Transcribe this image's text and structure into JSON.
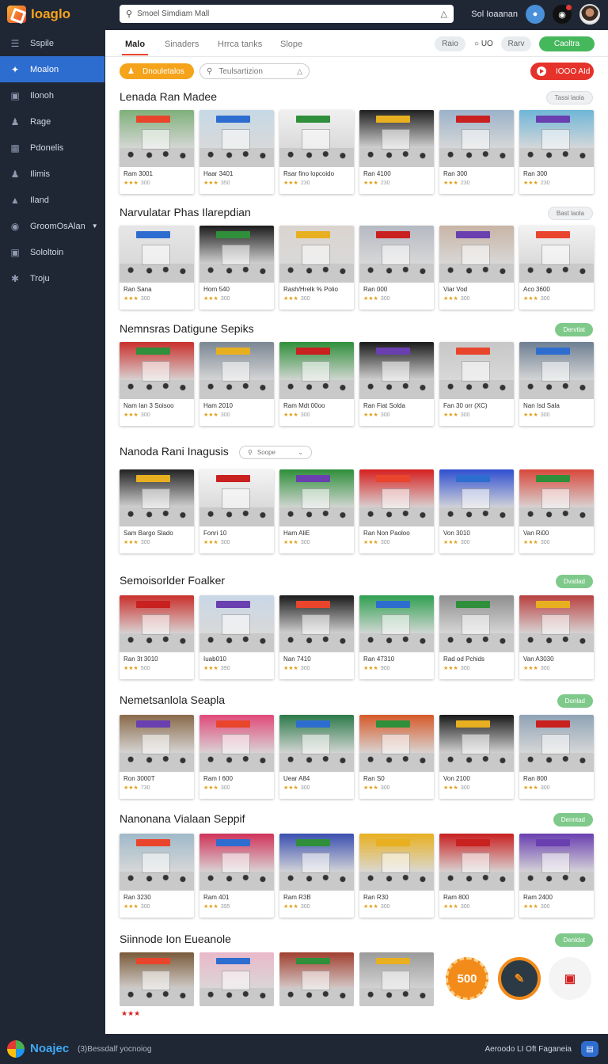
{
  "app": {
    "name": "Ioaglo",
    "search_placeholder": "Smoel Simdiam Mall",
    "top_link": "Sol Ioaanan"
  },
  "sidebar": [
    {
      "label": "Sspile",
      "icon": "menu-icon"
    },
    {
      "label": "Moalon",
      "icon": "bird-icon"
    },
    {
      "label": "Ilonoh",
      "icon": "bag-icon"
    },
    {
      "label": "Rage",
      "icon": "user-icon"
    },
    {
      "label": "Pdonelis",
      "icon": "chart-icon"
    },
    {
      "label": "Ilimis",
      "icon": "person-icon"
    },
    {
      "label": "Iland",
      "icon": "pin-icon"
    },
    {
      "label": "GroomOsAlan",
      "icon": "globe-icon"
    },
    {
      "label": "Sololtoin",
      "icon": "shield-icon"
    },
    {
      "label": "Troju",
      "icon": "gear-icon"
    }
  ],
  "tabs": [
    "Malo",
    "Sinaders",
    "Hrrca tanks",
    "Slope"
  ],
  "tab_controls": {
    "pill1": "Raio",
    "ring": "○ UO",
    "pill2": "Rarv",
    "pill3": "Caoltra"
  },
  "toolbar": {
    "orange": "Dnouletalos",
    "filter": "Teulsartizion",
    "red": "IOOO AId"
  },
  "sections": [
    {
      "title": "Lenada Ran Madee",
      "action": "Tassi laola",
      "action_style": "grey",
      "cards": [
        {
          "name": "Ram 3001",
          "score": "300"
        },
        {
          "name": "Haar 3401",
          "score": "350"
        },
        {
          "name": "Rsar fino lopcoido",
          "score": "230"
        },
        {
          "name": "Ran 4100",
          "score": "230"
        },
        {
          "name": "Ran 300",
          "score": "230"
        },
        {
          "name": "Ran 300",
          "score": "230"
        }
      ]
    },
    {
      "title": "Narvulatar Phas Ilarepdian",
      "action": "Bast laola",
      "action_style": "grey",
      "cards": [
        {
          "name": "Ran Sana",
          "score": "300"
        },
        {
          "name": "Horn 540",
          "score": "300"
        },
        {
          "name": "Rash/Hrelk % Polio",
          "score": "300"
        },
        {
          "name": "Ran 000",
          "score": "300"
        },
        {
          "name": "Viar Vod",
          "score": "300"
        },
        {
          "name": "Aco 3600",
          "score": "300"
        }
      ]
    },
    {
      "title": "Nemnsras Datigune Sepiks",
      "action": "Dervtlat",
      "action_style": "green",
      "cards": [
        {
          "name": "Nam Ian 3 Soisoo",
          "score": "300"
        },
        {
          "name": "Ham 2010",
          "score": "300"
        },
        {
          "name": "Ram Mdt 00oo",
          "score": "300"
        },
        {
          "name": "Ran Fiat Solda",
          "score": "300"
        },
        {
          "name": "Fan 30 orr (XC)",
          "score": "300"
        },
        {
          "name": "Nan Isd Sala",
          "score": "300"
        }
      ]
    },
    {
      "title": "Nanoda Rani Inagusis",
      "action": "Soope",
      "action_style": "search",
      "cards": [
        {
          "name": "Sam Bargo Slado",
          "score": "300"
        },
        {
          "name": "Fonri 10",
          "score": "300"
        },
        {
          "name": "Harn AliE",
          "score": "300"
        },
        {
          "name": "Ran Non Paoloo",
          "score": "300"
        },
        {
          "name": "Von 3010",
          "score": "300"
        },
        {
          "name": "Van Ri00",
          "score": "300"
        }
      ]
    },
    {
      "title": "Semoisorlder Foalker",
      "action": "Dvatlad",
      "action_style": "green",
      "cards": [
        {
          "name": "Ran 3t 3010",
          "score": "500"
        },
        {
          "name": "Iuab010",
          "score": "390"
        },
        {
          "name": "Nan 7410",
          "score": "300"
        },
        {
          "name": "Ran 47310",
          "score": "900"
        },
        {
          "name": "Rad od Pchids",
          "score": "300"
        },
        {
          "name": "Van A3030",
          "score": "300"
        }
      ]
    },
    {
      "title": "Nemetsanlola Seapla",
      "action": "Donlad",
      "action_style": "green",
      "cards": [
        {
          "name": "Ron 3000T",
          "score": "730"
        },
        {
          "name": "Ram I 600",
          "score": "300"
        },
        {
          "name": "Uear A84",
          "score": "300"
        },
        {
          "name": "Ran S0",
          "score": "300"
        },
        {
          "name": "Von 2100",
          "score": "300"
        },
        {
          "name": "Ran 800",
          "score": "300"
        }
      ]
    },
    {
      "title": "Nanonana Vialaan Seppif",
      "action": "Denntad",
      "action_style": "green",
      "cards": [
        {
          "name": "Ran 3230",
          "score": "300"
        },
        {
          "name": "Ram 401",
          "score": "395"
        },
        {
          "name": "Ram R3B",
          "score": "300"
        },
        {
          "name": "Ran R30",
          "score": "300"
        },
        {
          "name": "Ram 800",
          "score": "300"
        },
        {
          "name": "Ram 2400",
          "score": "300"
        }
      ]
    },
    {
      "title": "Siinnode Ion Eueanole",
      "action": "Denldat",
      "action_style": "green"
    }
  ],
  "last_row": {
    "badge": "500",
    "stars": "★★★"
  },
  "footer": {
    "name": "Noajec",
    "sub": "(3)Bessdalf yocnoiog",
    "right": "Aeroodo LI Oft Faganeia",
    "btn": "▤"
  }
}
